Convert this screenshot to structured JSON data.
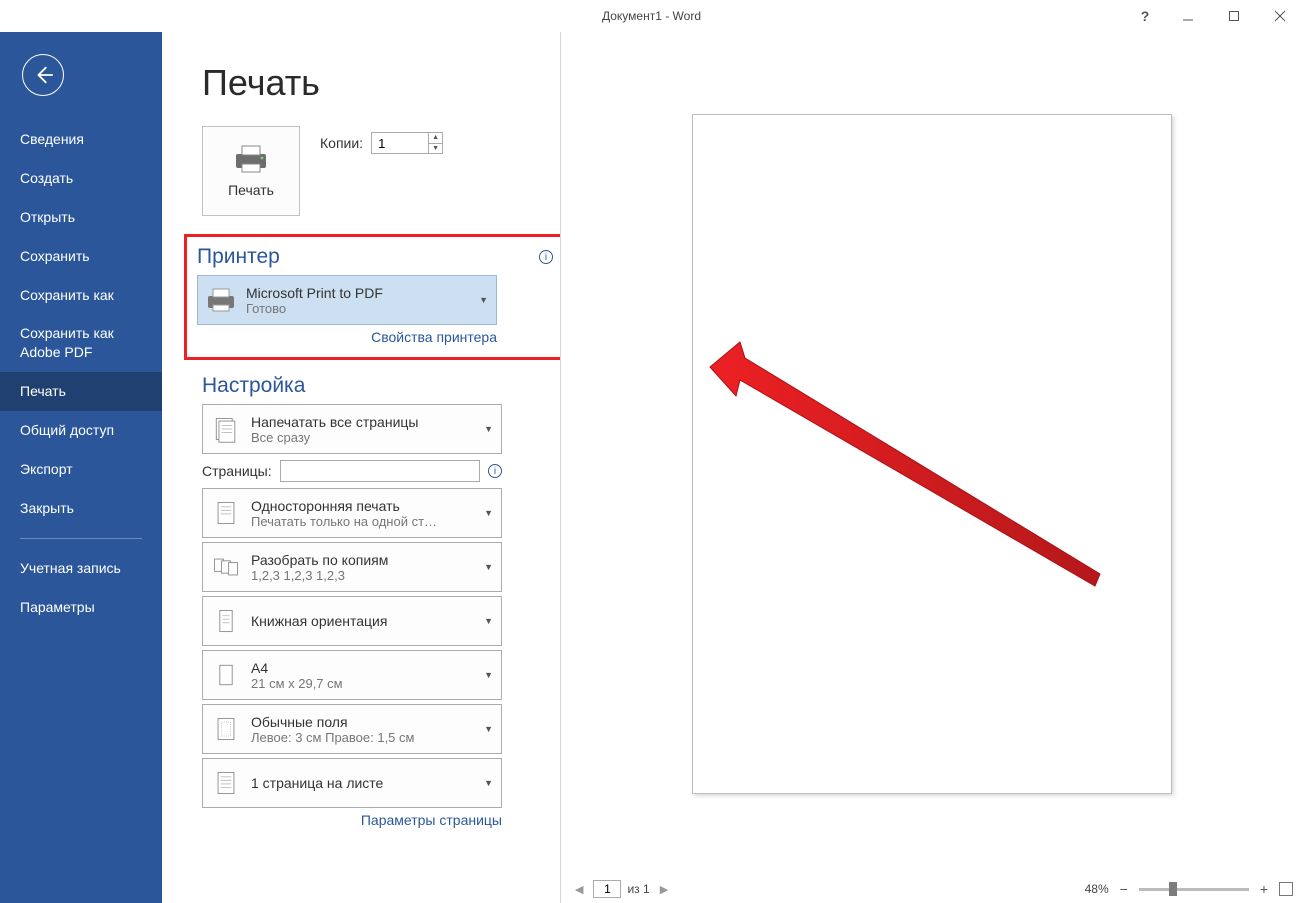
{
  "window": {
    "title": "Документ1 - Word"
  },
  "sidebar": {
    "items": [
      "Сведения",
      "Создать",
      "Открыть",
      "Сохранить",
      "Сохранить как",
      "Сохранить как Adobe PDF",
      "Печать",
      "Общий доступ",
      "Экспорт",
      "Закрыть"
    ],
    "account": "Учетная запись",
    "options": "Параметры",
    "active_index": 6
  },
  "print": {
    "page_title": "Печать",
    "print_button": "Печать",
    "copies_label": "Копии:",
    "copies_value": "1",
    "printer_section": "Принтер",
    "printer_name": "Microsoft Print to PDF",
    "printer_status": "Готово",
    "printer_properties": "Свойства принтера",
    "settings_section": "Настройка",
    "settings": [
      {
        "title": "Напечатать все страницы",
        "sub": "Все сразу"
      },
      {
        "title": "Односторонняя печать",
        "sub": "Печатать только на одной ст…"
      },
      {
        "title": "Разобрать по копиям",
        "sub": "1,2,3    1,2,3    1,2,3"
      },
      {
        "title": "Книжная ориентация",
        "sub": ""
      },
      {
        "title": "A4",
        "sub": "21 см x 29,7 см"
      },
      {
        "title": "Обычные поля",
        "sub": "Левое:  3 см   Правое:  1,5 см"
      },
      {
        "title": "1 страница на листе",
        "sub": ""
      }
    ],
    "pages_label": "Страницы:",
    "pages_value": "",
    "page_setup_link": "Параметры страницы"
  },
  "footer": {
    "current_page": "1",
    "of_label": "из 1",
    "zoom_percent": "48%"
  }
}
